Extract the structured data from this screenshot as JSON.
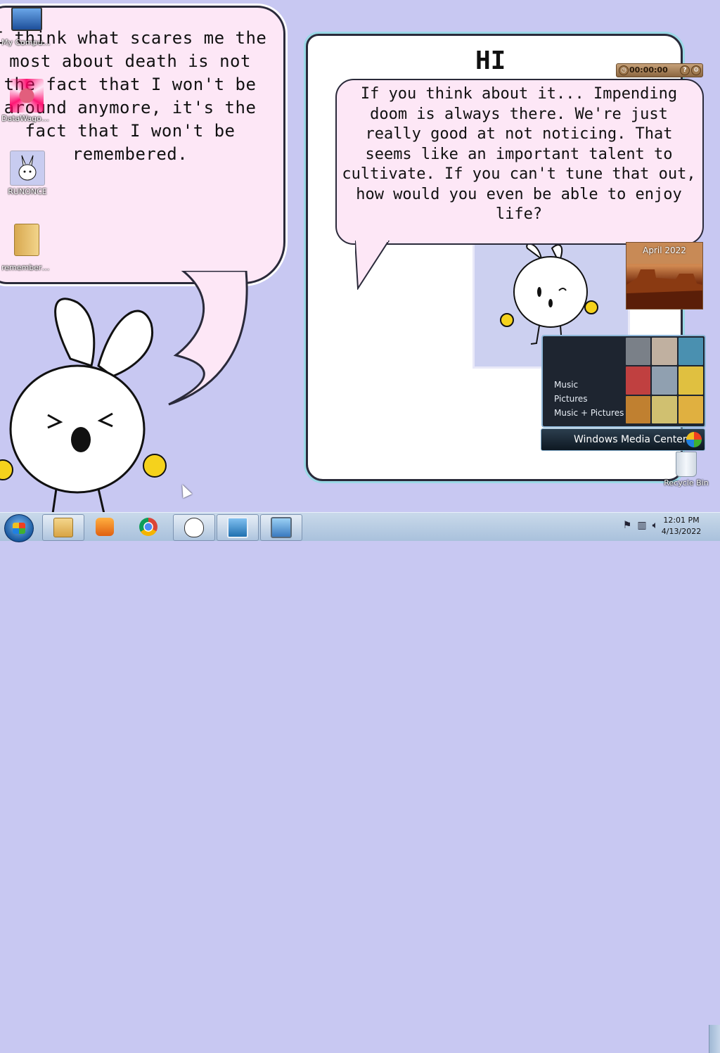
{
  "desktop": {
    "icons": [
      {
        "label": "My Computer"
      },
      {
        "label": "DataWagon..."
      },
      {
        "label": "RUNONCE"
      },
      {
        "label": "remember_..."
      },
      {
        "label": "Recycle Bin"
      }
    ]
  },
  "wallpaper": {
    "left_bubble_text": "I think what scares me the most about death is not the fact that I won't be around anymore, it's the fact that I won't be remembered.",
    "panel_heading": "HI",
    "inner_bubble_text": "If you think about it... Impending doom is always there. We're just really good at not noticing. That seems like an important talent to cultivate. If you can't tune that out, how would you even be able to enjoy life?"
  },
  "gadgets": {
    "timer": {
      "time": "00:00:00"
    },
    "slideshow": {
      "caption": "April 2022"
    },
    "media_center": {
      "items": [
        "Music",
        "Pictures",
        "Music + Pictures"
      ],
      "brand": "Windows Media Center"
    }
  },
  "taskbar": {
    "buttons": [
      {
        "name": "windows-explorer"
      },
      {
        "name": "windows-media-player"
      },
      {
        "name": "google-chrome"
      },
      {
        "name": "bunny-app"
      },
      {
        "name": "photo-viewer"
      },
      {
        "name": "remote-desktop"
      }
    ],
    "clock": {
      "time": "12:01 PM",
      "date": "4/13/2022"
    }
  },
  "colors": {
    "desktop_bg": "#c8c8f2",
    "bubble_pink": "#fde7f6",
    "taskbar": "#b9cde4"
  }
}
